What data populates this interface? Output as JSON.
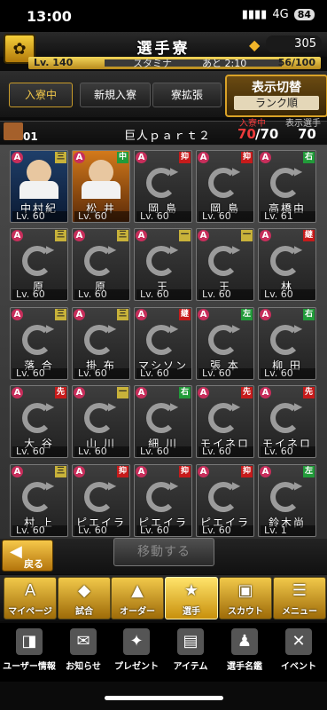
{
  "status_bar": {
    "time": "13:00",
    "network": "4G",
    "battery": "84"
  },
  "header": {
    "title": "選手寮",
    "currency_value": "305"
  },
  "level_bar": {
    "level": "Lv. 140",
    "stamina_label": "スタミナ",
    "timer": "あと 2:10",
    "stamina_value": "56/100"
  },
  "tabs": [
    {
      "label": "入寮中",
      "active": true
    },
    {
      "label": "新規入寮",
      "active": false
    },
    {
      "label": "寮拡張",
      "active": false
    }
  ],
  "sort": {
    "title": "表示切替",
    "mode": "ランク順"
  },
  "dorm": {
    "number": "01",
    "name": "巨人ｐａｒｔ２",
    "in_dorm_label": "入寮中",
    "in_dorm_current": "70",
    "in_dorm_total": "/70",
    "shown_label": "表示選手",
    "shown_count": "70"
  },
  "cards": [
    {
      "name": "中村紀",
      "level": "Lv. 60",
      "position": "三",
      "pos_color": "yellow",
      "photo": "blue"
    },
    {
      "name": "松 井",
      "level": "Lv. 60",
      "position": "中",
      "pos_color": "green",
      "photo": "orange"
    },
    {
      "name": "岡 島",
      "level": "Lv. 60",
      "position": "抑",
      "pos_color": "red"
    },
    {
      "name": "岡 島",
      "level": "Lv. 60",
      "position": "抑",
      "pos_color": "red"
    },
    {
      "name": "高橋由",
      "level": "Lv. 61",
      "position": "右",
      "pos_color": "green"
    },
    {
      "name": "原",
      "level": "Lv. 60",
      "position": "三",
      "pos_color": "yellow"
    },
    {
      "name": "原",
      "level": "Lv. 60",
      "position": "三",
      "pos_color": "yellow"
    },
    {
      "name": "王",
      "level": "Lv. 60",
      "position": "一",
      "pos_color": "yellow"
    },
    {
      "name": "王",
      "level": "Lv. 60",
      "position": "一",
      "pos_color": "yellow"
    },
    {
      "name": "林",
      "level": "Lv. 60",
      "position": "継",
      "pos_color": "red"
    },
    {
      "name": "落 合",
      "level": "Lv. 60",
      "position": "三",
      "pos_color": "yellow"
    },
    {
      "name": "掛 布",
      "level": "Lv. 60",
      "position": "三",
      "pos_color": "yellow"
    },
    {
      "name": "マシソン",
      "level": "Lv. 60",
      "position": "継",
      "pos_color": "red"
    },
    {
      "name": "張 本",
      "level": "Lv. 60",
      "position": "左",
      "pos_color": "green"
    },
    {
      "name": "柳 田",
      "level": "Lv. 60",
      "position": "右",
      "pos_color": "green"
    },
    {
      "name": "大 谷",
      "level": "Lv. 60",
      "position": "先",
      "pos_color": "red"
    },
    {
      "name": "山 川",
      "level": "Lv. 60",
      "position": "一",
      "pos_color": "yellow"
    },
    {
      "name": "細 川",
      "level": "Lv. 60",
      "position": "右",
      "pos_color": "green"
    },
    {
      "name": "モイネロ",
      "level": "Lv. 60",
      "position": "先",
      "pos_color": "red"
    },
    {
      "name": "モイネロ",
      "level": "Lv. 60",
      "position": "先",
      "pos_color": "red"
    },
    {
      "name": "村 上",
      "level": "Lv. 60",
      "position": "三",
      "pos_color": "yellow"
    },
    {
      "name": "ピエイラ",
      "level": "Lv. 60",
      "position": "抑",
      "pos_color": "red"
    },
    {
      "name": "ピエイラ",
      "level": "Lv. 60",
      "position": "抑",
      "pos_color": "red"
    },
    {
      "name": "ピエイラ",
      "level": "Lv. 60",
      "position": "抑",
      "pos_color": "red"
    },
    {
      "name": "鈴木尚",
      "level": "Lv. 1",
      "position": "左",
      "pos_color": "green"
    }
  ],
  "controls": {
    "back_label": "戻る",
    "move_label": "移動する"
  },
  "main_nav": [
    {
      "label": "マイページ",
      "icon": "A"
    },
    {
      "label": "試合",
      "icon": "◆"
    },
    {
      "label": "オーダー",
      "icon": "▲"
    },
    {
      "label": "選手",
      "icon": "★",
      "active": true
    },
    {
      "label": "スカウト",
      "icon": "▣"
    },
    {
      "label": "メニュー",
      "icon": "☰"
    }
  ],
  "sub_nav": [
    {
      "label": "ユーザー情報",
      "icon": "◨"
    },
    {
      "label": "お知らせ",
      "icon": "✉"
    },
    {
      "label": "プレゼント",
      "icon": "✦"
    },
    {
      "label": "アイテム",
      "icon": "▤"
    },
    {
      "label": "選手名鑑",
      "icon": "♟"
    },
    {
      "label": "イベント",
      "icon": "✕"
    }
  ],
  "colors": {
    "accent": "#f2c84a",
    "red": "#ee3b3b",
    "green": "#229b3a",
    "badge": "#c72e5b"
  }
}
